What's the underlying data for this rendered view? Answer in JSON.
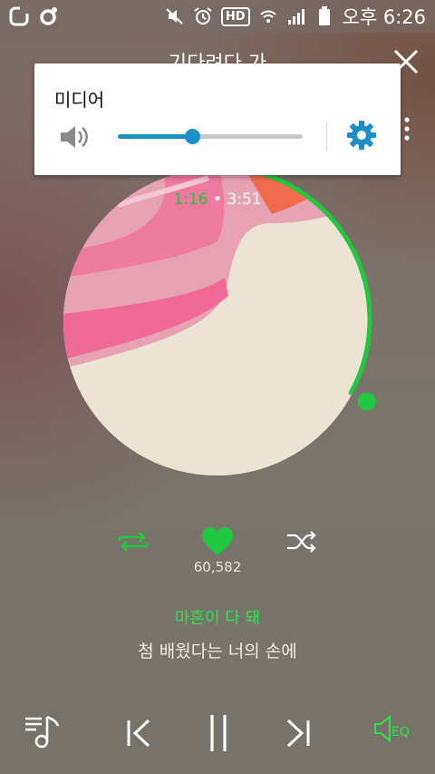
{
  "status_bar": {
    "icons_left": [
      "o-app-icon",
      "o-notification-icon"
    ],
    "icons_right": [
      "mute-icon",
      "alarm-icon",
      "hd-icon",
      "wifi-icon",
      "signal-icon",
      "battery-icon"
    ],
    "hd_badge": "HD",
    "time": "오후 6:26"
  },
  "player": {
    "song_title": "기다려다 가",
    "current_time": "1:16",
    "separator": "•",
    "total_time": "3:51",
    "progress": 0.33,
    "like_count": "60,582",
    "lyric_current": "마흔이 다 돼",
    "lyric_next": "첨 배웠다는 너의 손에",
    "eq_label": "EQ"
  },
  "volume_popup": {
    "label": "미디어",
    "level": 0.4
  },
  "colors": {
    "accent_green": "#20c83f",
    "volume_blue": "#1b8fc6"
  }
}
